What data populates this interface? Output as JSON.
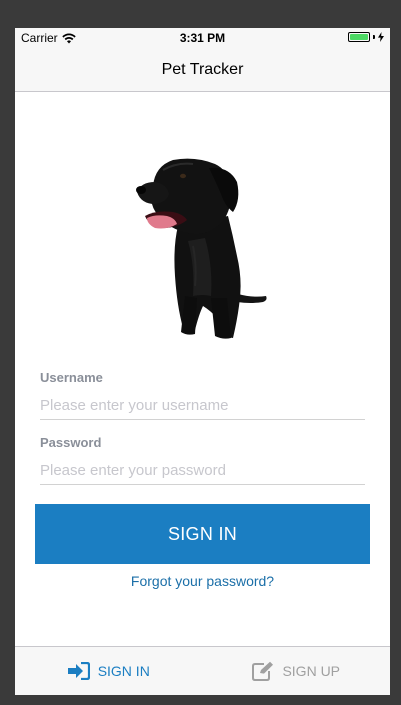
{
  "status_bar": {
    "carrier": "Carrier",
    "time": "3:31 PM"
  },
  "nav": {
    "title": "Pet Tracker"
  },
  "form": {
    "username_label": "Username",
    "username_placeholder": "Please enter your username",
    "username_value": "",
    "password_label": "Password",
    "password_placeholder": "Please enter your password",
    "password_value": ""
  },
  "actions": {
    "sign_in_label": "SIGN IN",
    "forgot_password_label": "Forgot your password?"
  },
  "tabs": [
    {
      "label": "SIGN IN",
      "icon": "sign-in-icon",
      "active": true
    },
    {
      "label": "SIGN UP",
      "icon": "edit-icon",
      "active": false
    }
  ],
  "colors": {
    "primary": "#1b7ec2",
    "link": "#1b6fa8",
    "inactive_tab": "#a0a0a0",
    "battery": "#4cd964"
  }
}
